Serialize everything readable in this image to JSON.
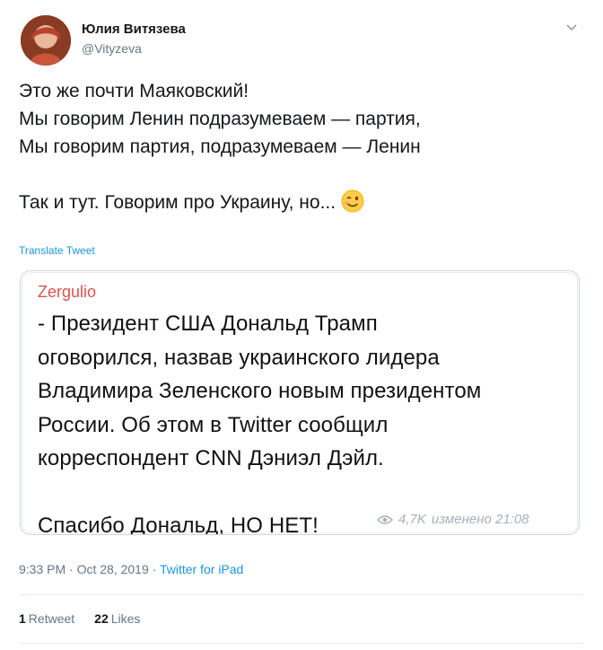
{
  "author": {
    "name": "Юлия Витязева",
    "handle": "@Vityzeva"
  },
  "tweet": {
    "text": "Это же почти Маяковский!\nМы говорим Ленин подразумеваем — партия,\nМы говорим партия, подразумеваем — Ленин\n\nТак и тут. Говорим про Украину, но...",
    "emoji": "winking-face-emoji",
    "translate_label": "Translate Tweet"
  },
  "quote": {
    "author": "Zergulio",
    "text": "- Президент США Дональд Трамп\nоговорился, назвав украинского лидера\nВладимира Зеленского новым президентом\nРоссии. Об этом в Twitter сообщил\nкорреспондент CNN Дэниэл Дэйл.\n\nСпасибо Дональд, НО НЕТ!",
    "views": "4,7K",
    "edited": "изменено 21:08",
    "author_color": "#d9534f"
  },
  "meta": {
    "time": "9:33 PM",
    "separator": " · ",
    "date": "Oct 28, 2019",
    "source": "Twitter for iPad"
  },
  "stats": {
    "retweets_count": "1",
    "retweets_label": "Retweet",
    "likes_count": "22",
    "likes_label": "Likes"
  },
  "colors": {
    "link": "#1b95e0",
    "muted": "#657786",
    "border": "#ccd6dd"
  }
}
